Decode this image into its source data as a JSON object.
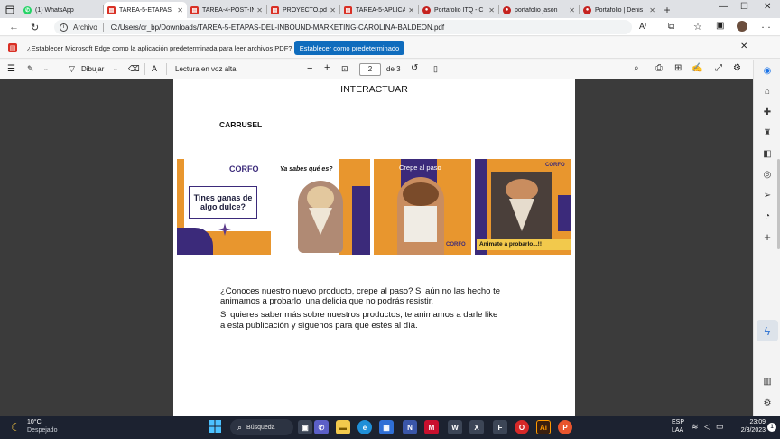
{
  "tabs": [
    {
      "label": "(1) WhatsApp",
      "color": "#25d366"
    },
    {
      "label": "TAREA-5-ETAPAS",
      "color": "#d93025"
    },
    {
      "label": "TAREA-4-POST-IN",
      "color": "#d93025"
    },
    {
      "label": "PROYECTO.pdf",
      "color": "#d93025"
    },
    {
      "label": "TAREA-5-APLICAC",
      "color": "#d93025"
    },
    {
      "label": "Portafolio ITQ - C",
      "color": "#c5221f"
    },
    {
      "label": "portafolio jason",
      "color": "#c5221f"
    },
    {
      "label": "Portafolio | Denis",
      "color": "#c5221f"
    }
  ],
  "address": {
    "label": "Archivo",
    "url": "C:/Users/cr_bp/Downloads/TAREA-5-ETAPAS-DEL-INBOUND-MARKETING-CAROLINA-BALDEON.pdf"
  },
  "notification": {
    "text": "¿Establecer Microsoft Edge como la aplicación predeterminada para leer archivos PDF?",
    "button": "Establecer como predeterminado"
  },
  "pdf_toolbar": {
    "draw": "Dibujar",
    "read_aloud": "Lectura en voz alta",
    "page_current": "2",
    "page_total": "de 3"
  },
  "document": {
    "heading": "INTERACTUAR",
    "section": "CARRUSEL",
    "paragraph1_line1": "¿Conoces nuestro nuevo producto, crepe al paso? Si aún no las hecho te",
    "paragraph1_line2": "animamos a probarlo, una delicia que no podrás resistir.",
    "paragraph2_line1": "Si quieres saber más sobre nuestros productos, te animamos a darle like",
    "paragraph2_line2": "a esta publicación y síguenos para que estés al día.",
    "slides": [
      {
        "brand": "CORFO",
        "tagline": "Tines ganas de algo dulce?"
      },
      {
        "caption": "Ya sabes qué es?"
      },
      {
        "caption": "Crepe al paso"
      },
      {
        "caption": "Animate a probarlo...!!"
      }
    ]
  },
  "colors": {
    "accent": "#0f6cbd",
    "brand_orange": "#e8962e",
    "brand_purple": "#3b2a7a",
    "brand_pink": "#e23b5c"
  },
  "taskbar": {
    "temp": "10°C",
    "weather": "Despejado",
    "search": "Búsqueda",
    "lang1": "ESP",
    "lang2": "LAA",
    "time": "23:09",
    "date": "2/3/2023"
  }
}
